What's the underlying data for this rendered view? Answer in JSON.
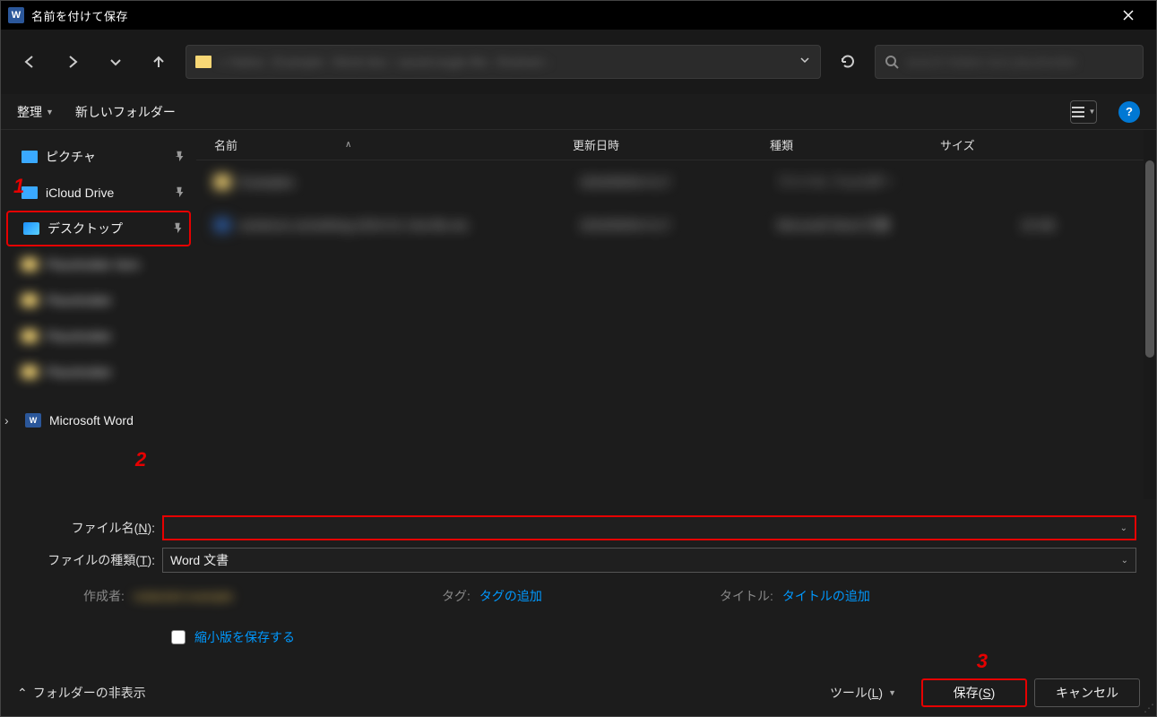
{
  "titlebar": {
    "title": "名前を付けて保存"
  },
  "nav": {
    "breadcrumbs_blur": "«   Hatira   ›   Example   ›   Word doc   ›   saved-eagle-file › finished  ›",
    "search_placeholder_blur": "search hidden text placeholder"
  },
  "toolbar": {
    "organize": "整理",
    "new_folder": "新しいフォルダー"
  },
  "annotations": {
    "n1": "1",
    "n2": "2",
    "n3": "3"
  },
  "sidebar": {
    "items": [
      {
        "label": "ピクチャ",
        "icon": "folder-b",
        "pinned": true
      },
      {
        "label": "iCloud Drive",
        "icon": "folder-b",
        "pinned": true
      },
      {
        "label": "デスクトップ",
        "icon": "monitor",
        "pinned": true,
        "selected": true
      },
      {
        "label": "Placeholder Item",
        "icon": "folder-y",
        "blur": true
      },
      {
        "label": "Placeholder",
        "icon": "folder-y",
        "blur": true
      },
      {
        "label": "Placeholder",
        "icon": "folder-y",
        "blur": true
      },
      {
        "label": "Placeholder",
        "icon": "folder-y",
        "blur": true
      },
      {
        "label": "Microsoft Word",
        "icon": "word",
        "expandable": true
      }
    ]
  },
  "columns": {
    "name": "名前",
    "date": "更新日時",
    "type": "種類",
    "size": "サイズ"
  },
  "rows_blur": [
    {
      "icon": "folder",
      "name": "Examples",
      "date": "2024/05/04 9:17",
      "type": "ファイル フォルダー",
      "size": ""
    },
    {
      "icon": "word",
      "name": "sentence-something-2024-01-10a-file-etc",
      "date": "2024/05/04 9:17",
      "type": "Microsoft Word 文書",
      "size": "15 KB"
    }
  ],
  "form": {
    "filename_label": "ファイル名(N):",
    "filename_value": "",
    "filetype_label": "ファイルの種類(T):",
    "filetype_value": "Word 文書",
    "author_label": "作成者:",
    "author_value_blur": "redacted example",
    "tags_label": "タグ:",
    "tags_value": "タグの追加",
    "title_label": "タイトル:",
    "title_value": "タイトルの追加",
    "thumbnail_label": "縮小版を保存する"
  },
  "footer": {
    "hide_folders": "フォルダーの非表示",
    "tools": "ツール(L)",
    "save": "保存(S)",
    "cancel": "キャンセル"
  }
}
